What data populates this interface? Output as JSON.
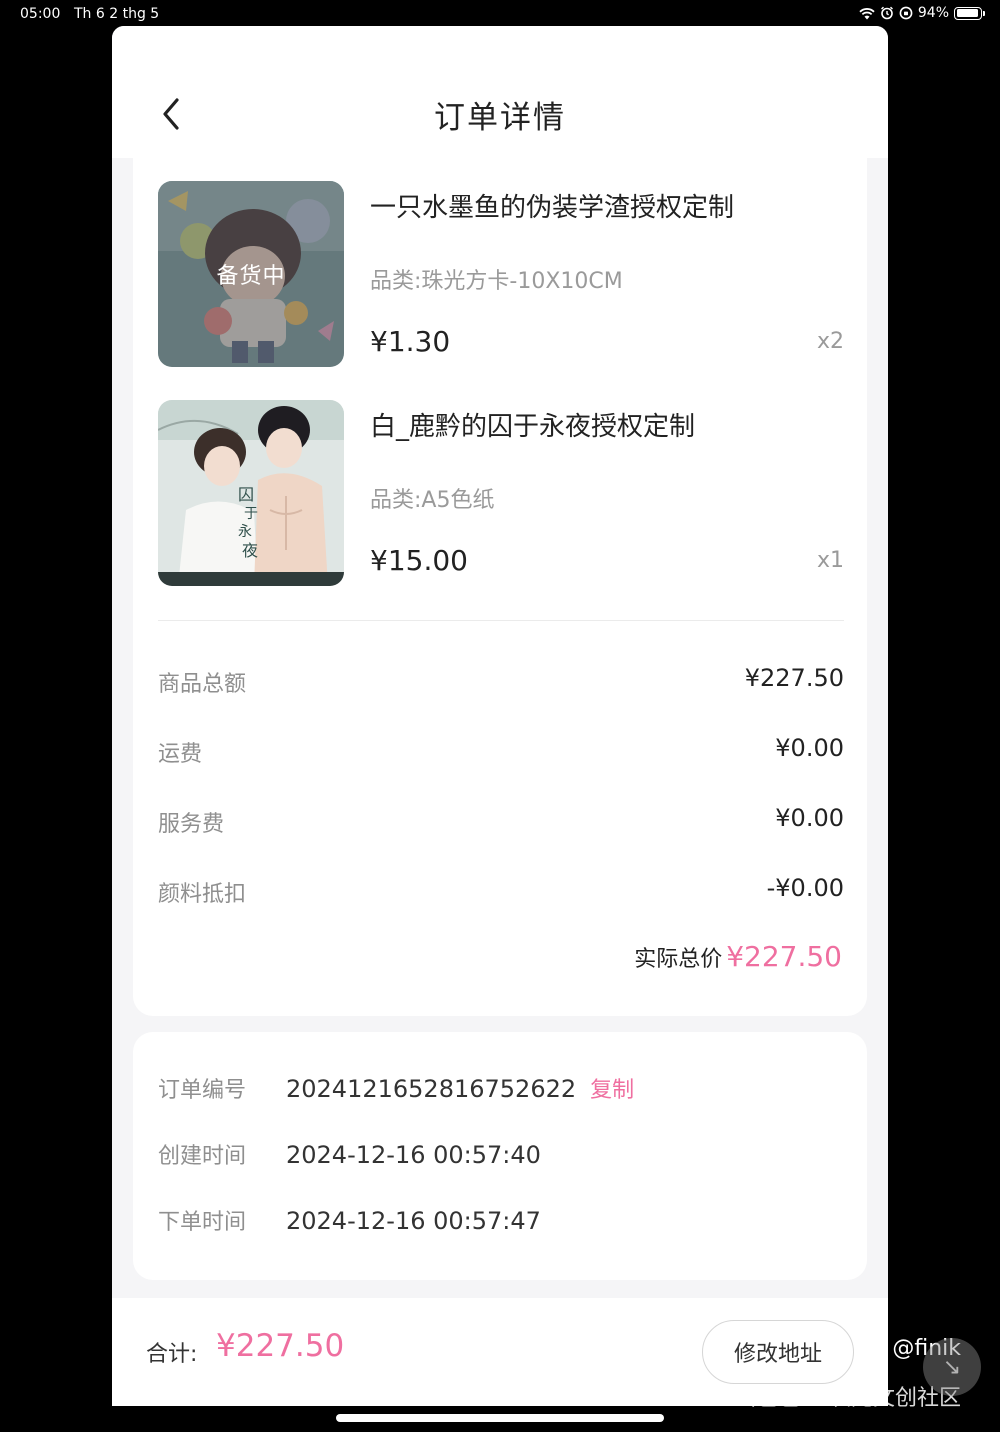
{
  "status_bar": {
    "time": "05:00",
    "date": "Th 6 2 thg 5",
    "battery": "94%",
    "battery_level": 0.94
  },
  "header": {
    "title": "订单详情",
    "back_icon": "chevron-left-icon"
  },
  "items": [
    {
      "title": "一只水墨鱼的伪装学渣授权定制",
      "category": "品类:珠光方卡-10X10CM",
      "price": "¥1.30",
      "quantity": "x2",
      "badge": "备货中"
    },
    {
      "title": "白_鹿黔的囚于永夜授权定制",
      "category": "品类:A5色纸",
      "price": "¥15.00",
      "quantity": "x1"
    }
  ],
  "summary": {
    "goods_total_label": "商品总额",
    "goods_total": "¥227.50",
    "shipping_label": "运费",
    "shipping": "¥0.00",
    "service_label": "服务费",
    "service": "¥0.00",
    "pigment_label": "颜料抵扣",
    "pigment": "-¥0.00",
    "actual_label": "实际总价",
    "actual": "¥227.50"
  },
  "order_info": {
    "number_label": "订单编号",
    "number": "2024121652816752622",
    "copy_label": "复制",
    "created_label": "创建时间",
    "created": "2024-12-16 00:57:40",
    "placed_label": "下单时间",
    "placed": "2024-12-16 00:57:47"
  },
  "footer": {
    "total_label": "合计:",
    "total": "¥227.50",
    "edit_address_label": "修改地址"
  },
  "watermark": {
    "handle": "@finik",
    "brand": "画包包·二次元文创社区"
  },
  "colors": {
    "accent": "#ef6fa0",
    "background": "#f5f5f7",
    "muted_text": "#8f8f8f"
  }
}
